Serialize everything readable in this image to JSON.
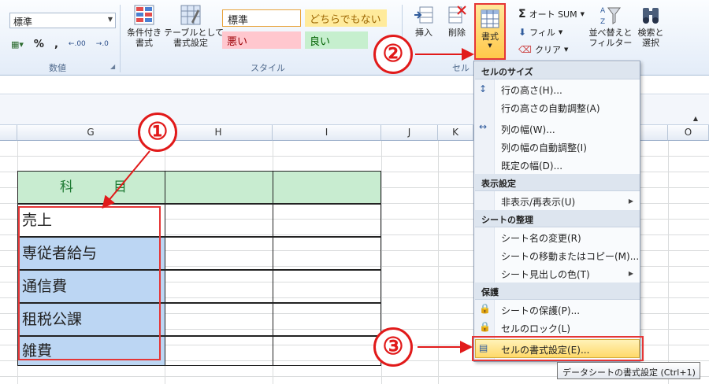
{
  "ribbon": {
    "number_format_value": "標準",
    "number_group_label": "数値",
    "number_buttons": [
      "%",
      ","
    ],
    "decimal_increase_label": ".00",
    "decimal_decrease_label": "→.0",
    "conditional_format_label": "条件付き\n書式",
    "format_as_table_label": "テーブルとして\n書式設定",
    "styles": {
      "normal": "標準",
      "neutral": "どちらでもない",
      "bad": "悪い",
      "good": "良い"
    },
    "styles_group_label": "スタイル",
    "insert_label": "挿入",
    "delete_label": "削除",
    "format_label": "書式",
    "cells_group_label": "セル",
    "autosum_label": "オート SUM",
    "fill_label": "フィル",
    "clear_label": "クリア",
    "sort_filter_label": "並べ替えと\nフィルター",
    "find_select_label": "検索と\n選択"
  },
  "colors": {
    "accent_red": "#e11a1a",
    "header_green": "#c8ecd0",
    "selection_blue": "#bcd6f3",
    "style_bad": "#ffc7ce",
    "style_good": "#c6efce",
    "style_neutral": "#ffeb9c"
  },
  "columns": [
    "G",
    "H",
    "I",
    "J",
    "K",
    "O"
  ],
  "sheet": {
    "header_label": "科　　　目",
    "rows": [
      "売上",
      "専従者給与",
      "通信費",
      "租税公課",
      "雑費"
    ]
  },
  "menu": {
    "sections": [
      {
        "header": "セルのサイズ",
        "items": [
          {
            "label": "行の高さ(H)...",
            "icon": "row-height-icon"
          },
          {
            "label": "行の高さの自動調整(A)",
            "icon": ""
          },
          {
            "label": "列の幅(W)...",
            "icon": "column-width-icon"
          },
          {
            "label": "列の幅の自動調整(I)",
            "icon": ""
          },
          {
            "label": "既定の幅(D)...",
            "icon": ""
          }
        ]
      },
      {
        "header": "表示設定",
        "items": [
          {
            "label": "非表示/再表示(U)",
            "icon": "",
            "submenu": true
          }
        ]
      },
      {
        "header": "シートの整理",
        "items": [
          {
            "label": "シート名の変更(R)",
            "icon": ""
          },
          {
            "label": "シートの移動またはコピー(M)...",
            "icon": ""
          },
          {
            "label": "シート見出しの色(T)",
            "icon": "",
            "submenu": true
          }
        ]
      },
      {
        "header": "保護",
        "items": [
          {
            "label": "シートの保護(P)...",
            "icon": "protect-sheet-icon"
          },
          {
            "label": "セルのロック(L)",
            "icon": "lock-icon"
          },
          {
            "label": "セルの書式設定(E)...",
            "icon": "format-cells-icon"
          }
        ]
      }
    ]
  },
  "tooltip": "データシートの書式設定 (Ctrl+1)",
  "annotations": [
    "①",
    "②",
    "③"
  ]
}
